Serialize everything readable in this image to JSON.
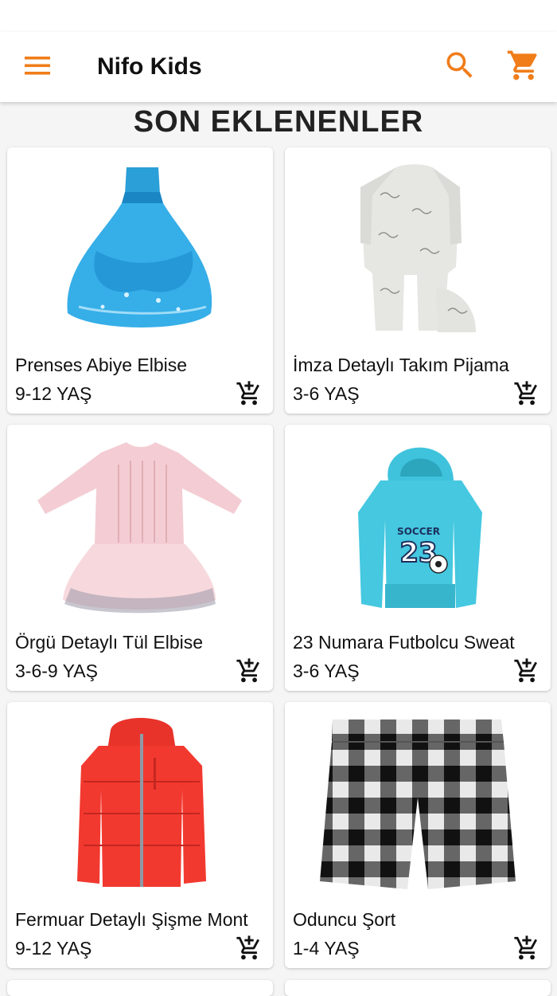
{
  "app": {
    "title": "Nifo Kids",
    "accent_color": "#f07d1a",
    "icons": {
      "menu": "hamburger-menu-icon",
      "search": "search-icon",
      "cart": "shopping-cart-icon",
      "add_to_cart": "add-shopping-cart-icon"
    }
  },
  "section": {
    "title": "SON EKLENENLER"
  },
  "products": [
    {
      "name": "Prenses Abiye Elbise",
      "age": "9-12 YAŞ",
      "image": "blue-ball-gown"
    },
    {
      "name": "İmza Detaylı Takım Pijama",
      "age": "3-6 YAŞ",
      "image": "grey-baby-onesie"
    },
    {
      "name": "Örgü Detaylı Tül Elbise",
      "age": "3-6-9 YAŞ",
      "image": "pink-knit-tulle-dress"
    },
    {
      "name": "23 Numara Futbolcu Sweat",
      "age": "3-6 YAŞ",
      "image": "turquoise-soccer-hoodie"
    },
    {
      "name": "Fermuar Detaylı Şişme Mont",
      "age": "9-12 YAŞ",
      "image": "red-puffer-jacket"
    },
    {
      "name": "Oduncu Şort",
      "age": "1-4 YAŞ",
      "image": "plaid-shorts"
    }
  ],
  "product_artwork_text": {
    "hoodie_print": "SOCCER",
    "hoodie_number": "23"
  }
}
